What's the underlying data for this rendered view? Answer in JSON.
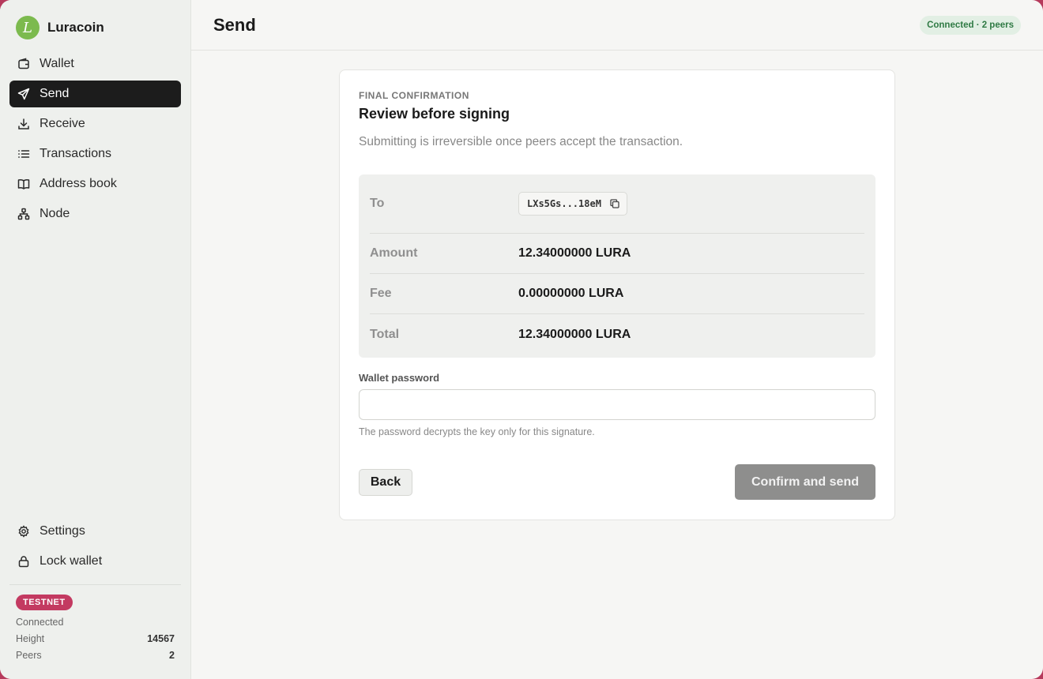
{
  "app": {
    "name": "Luracoin",
    "logo_glyph": "L",
    "accent": "#7cba4e"
  },
  "sidebar": {
    "nav": [
      {
        "label": "Wallet",
        "icon": "wallet-icon"
      },
      {
        "label": "Send",
        "icon": "send-icon",
        "active": true
      },
      {
        "label": "Receive",
        "icon": "download-icon"
      },
      {
        "label": "Transactions",
        "icon": "list-icon"
      },
      {
        "label": "Address book",
        "icon": "book-icon"
      },
      {
        "label": "Node",
        "icon": "network-icon"
      }
    ],
    "bottom": [
      {
        "label": "Settings",
        "icon": "gear-icon"
      },
      {
        "label": "Lock wallet",
        "icon": "lock-icon"
      }
    ],
    "status": {
      "network_badge": "TESTNET",
      "connection": "Connected",
      "height_label": "Height",
      "height_value": "14567",
      "peers_label": "Peers",
      "peers_value": "2"
    }
  },
  "header": {
    "title": "Send",
    "connection_badge": "Connected · 2 peers"
  },
  "confirm": {
    "eyebrow": "FINAL CONFIRMATION",
    "title": "Review before signing",
    "subtitle": "Submitting is irreversible once peers accept the transaction.",
    "to_label": "To",
    "to_address": "LXs5Gs...18eM",
    "rows": [
      {
        "label": "Amount",
        "value": "12.34000000 LURA"
      },
      {
        "label": "Fee",
        "value": "0.00000000 LURA"
      },
      {
        "label": "Total",
        "value": "12.34000000 LURA"
      }
    ],
    "password_label": "Wallet password",
    "password_value": "",
    "password_help": "The password decrypts the key only for this signature.",
    "back_label": "Back",
    "confirm_label": "Confirm and send"
  }
}
